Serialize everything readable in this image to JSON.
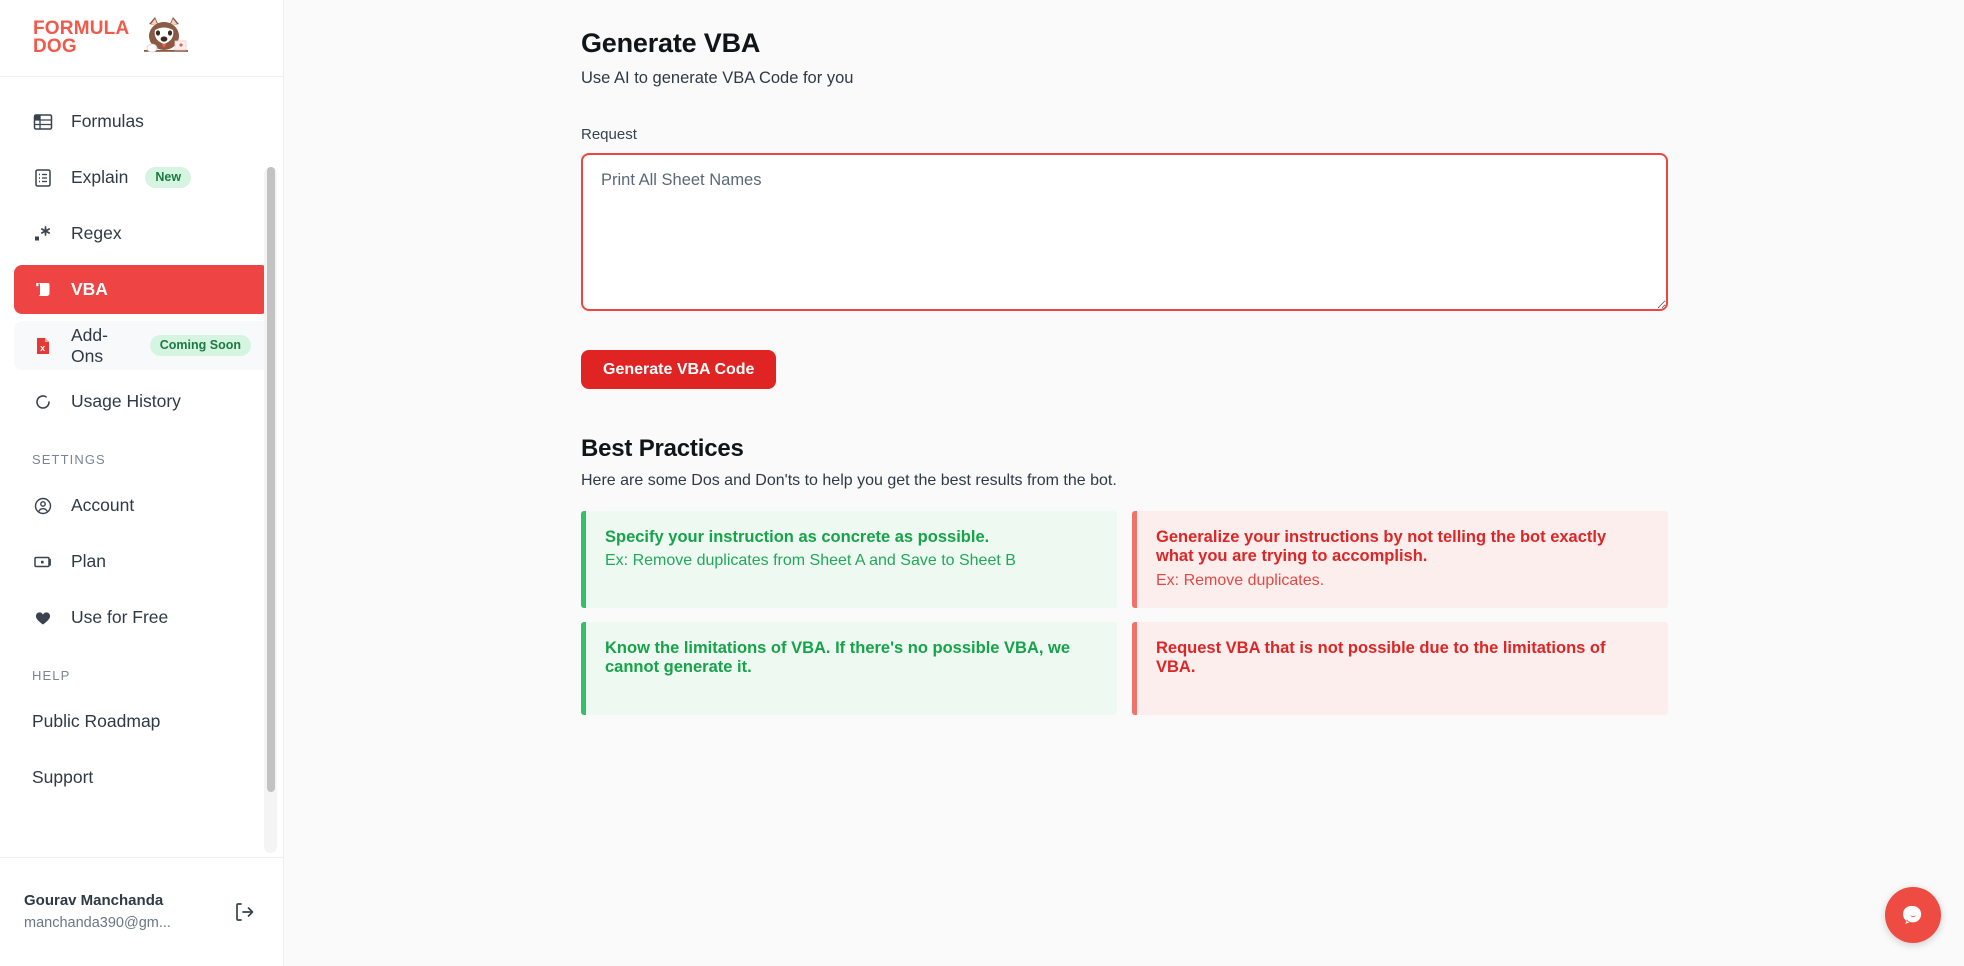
{
  "brand": {
    "line1": "FORMULA",
    "line2": "DOG",
    "accent_color": "#f2594b"
  },
  "sidebar": {
    "items": [
      {
        "label": "Formulas",
        "icon": "table-grid-icon",
        "badge": "",
        "state": "normal"
      },
      {
        "label": "Explain",
        "icon": "document-lines-icon",
        "badge": "New",
        "state": "normal"
      },
      {
        "label": "Regex",
        "icon": "asterisk-icon",
        "badge": "",
        "state": "normal"
      },
      {
        "label": "VBA",
        "icon": "vba-scroll-icon",
        "badge": "",
        "state": "active"
      },
      {
        "label": "Add-Ons",
        "icon": "excel-file-icon",
        "badge": "Coming Soon",
        "state": "hovered"
      },
      {
        "label": "Usage History",
        "icon": "history-circle-icon",
        "badge": "",
        "state": "normal"
      }
    ],
    "settings_label": "SETTINGS",
    "settings_items": [
      {
        "label": "Account",
        "icon": "user-circle-icon"
      },
      {
        "label": "Plan",
        "icon": "card-icon"
      },
      {
        "label": "Use for Free",
        "icon": "heart-icon"
      }
    ],
    "help_label": "HELP",
    "help_items": [
      {
        "label": "Public Roadmap"
      },
      {
        "label": "Support"
      }
    ],
    "active_color": "#ef4444"
  },
  "user": {
    "name": "Gourav Manchanda",
    "email": "manchanda390@gm...",
    "logout_icon": "logout-icon"
  },
  "main": {
    "title": "Generate VBA",
    "subtitle": "Use AI to generate VBA Code for you",
    "request_label": "Request",
    "request_placeholder": "Print All Sheet Names",
    "request_value": "",
    "generate_button": "Generate VBA Code",
    "best_practices_title": "Best Practices",
    "best_practices_subtitle": "Here are some Dos and Don'ts to help you get the best results from the bot.",
    "cards": [
      {
        "type": "good",
        "heading": "Specify your instruction as concrete as possible.",
        "example": "Ex: Remove duplicates from Sheet A and Save to Sheet B"
      },
      {
        "type": "bad",
        "heading": "Generalize your instructions by not telling the bot exactly what you are trying to accomplish.",
        "example": "Ex: Remove duplicates."
      },
      {
        "type": "good",
        "heading": "Know the limitations of VBA. If there's no possible VBA, we cannot generate it.",
        "example": ""
      },
      {
        "type": "bad",
        "heading": "Request VBA that is not possible due to the limitations of VBA.",
        "example": ""
      }
    ],
    "good_color": "#16a34a",
    "bad_color": "#dc2626",
    "button_color": "#e02424"
  },
  "chat": {
    "icon": "chat-bubble-icon",
    "color": "#ee4b42"
  }
}
